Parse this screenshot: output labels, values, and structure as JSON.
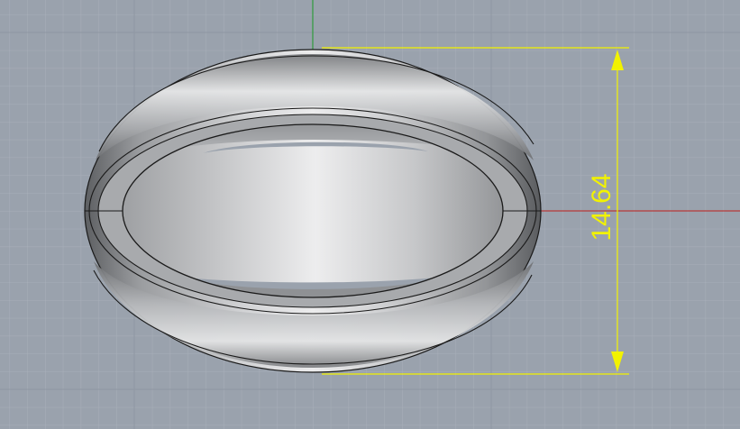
{
  "viewport": {
    "background_color": "#9aa2ad",
    "grid_minor_color": "#a7aeb8",
    "grid_major_color": "#8b939e",
    "x_axis_color": "#b83a3a",
    "y_axis_color": "#2f9a3c"
  },
  "model": {
    "object": "ring",
    "outline_color": "#1a1a1a"
  },
  "dimension": {
    "value_label": "14.64",
    "color": "#f2f200",
    "orientation": "vertical"
  }
}
